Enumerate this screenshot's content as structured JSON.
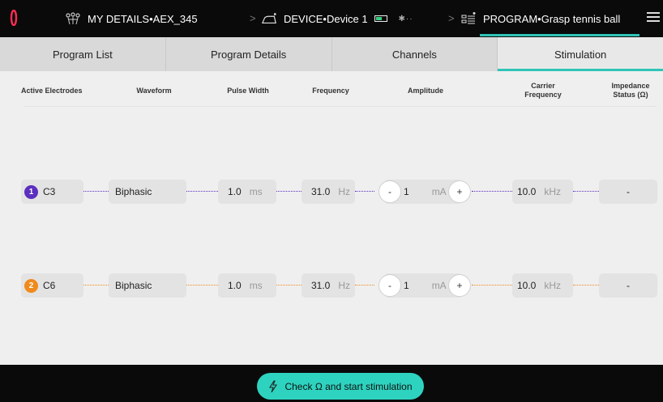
{
  "header": {
    "details_label": "MY DETAILS",
    "details_value": "AEX_345",
    "device_label": "DEVICE",
    "device_value": "Device 1",
    "program_label": "PROGRAM",
    "program_value": "Grasp tennis ball",
    "separator": " • ",
    "bluetooth_text": "✱··"
  },
  "tabs": [
    {
      "label": "Program List"
    },
    {
      "label": "Program Details"
    },
    {
      "label": "Channels"
    },
    {
      "label": "Stimulation",
      "active": true
    }
  ],
  "columns": {
    "electrodes": "Active Electrodes",
    "waveform": "Waveform",
    "pulse_width": "Pulse Width",
    "frequency": "Frequency",
    "amplitude": "Amplitude",
    "carrier": "Carrier Frequency",
    "impedance": "Impedance Status (Ω)"
  },
  "rows": [
    {
      "index": "1",
      "electrode": "C3",
      "color": "#5b2fbf",
      "waveform": "Biphasic",
      "pulse_width": "1.0",
      "pulse_unit": "ms",
      "frequency": "31.0",
      "frequency_unit": "Hz",
      "amplitude": "1",
      "amplitude_unit": "mA",
      "minus": "-",
      "plus": "+",
      "carrier": "10.0",
      "carrier_unit": "kHz",
      "impedance": "-"
    },
    {
      "index": "2",
      "electrode": "C6",
      "color": "#f08a1c",
      "waveform": "Biphasic",
      "pulse_width": "1.0",
      "pulse_unit": "ms",
      "frequency": "31.0",
      "frequency_unit": "Hz",
      "amplitude": "1",
      "amplitude_unit": "mA",
      "minus": "-",
      "plus": "+",
      "carrier": "10.0",
      "carrier_unit": "kHz",
      "impedance": "-"
    }
  ],
  "footer": {
    "start_label": "Check Ω and start stimulation"
  },
  "colors": {
    "accent": "#2ec4b6",
    "button": "#2ed3bf",
    "logo": "#ff2d55"
  }
}
